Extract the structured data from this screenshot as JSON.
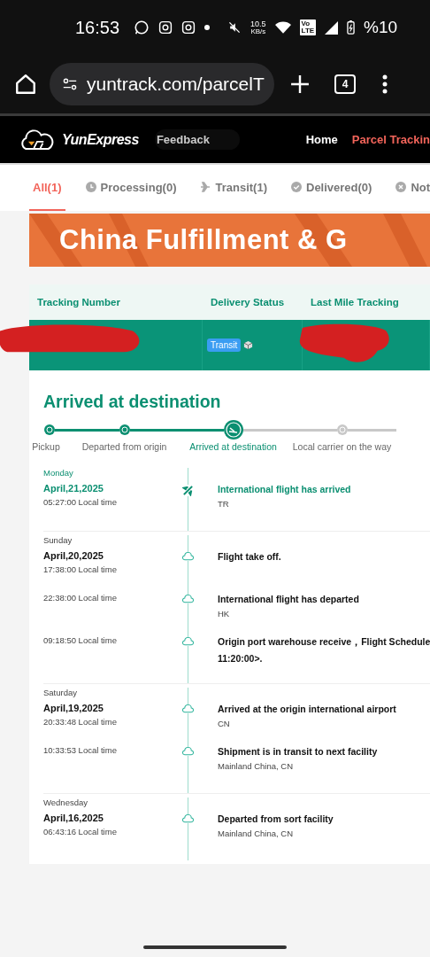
{
  "status_bar": {
    "time": "16:53",
    "speed": "10.5",
    "speed_unit": "KB/s",
    "volte": "Vo",
    "lte": "LTE",
    "battery": "%10"
  },
  "browser": {
    "url": "yuntrack.com/parcelT",
    "tab_count": "4"
  },
  "nav": {
    "brand": "YunExpress",
    "feedback": "Feedback",
    "links": [
      {
        "label": "Home",
        "selected": false
      },
      {
        "label": "Parcel Trackin",
        "selected": true
      }
    ]
  },
  "filter_tabs": [
    {
      "label": "All(1)",
      "kind": "all",
      "selected": true
    },
    {
      "label": "Processing(0)",
      "kind": "processing",
      "selected": false
    },
    {
      "label": "Transit(1)",
      "kind": "transit",
      "selected": false
    },
    {
      "label": "Delivered(0)",
      "kind": "delivered",
      "selected": false
    },
    {
      "label": "Not",
      "kind": "not",
      "selected": false
    }
  ],
  "banner": {
    "text": "China Fulfillment & G"
  },
  "table": {
    "columns": [
      "Tracking Number",
      "Delivery Status",
      "Last Mile Tracking"
    ],
    "row": {
      "status": "Transit"
    }
  },
  "detail": {
    "heading": "Arrived at destination",
    "steps": [
      {
        "label": "Pickup",
        "done": true,
        "current": false
      },
      {
        "label": "Departed from origin",
        "done": true,
        "current": false
      },
      {
        "label": "Arrived at destination",
        "done": true,
        "current": true
      },
      {
        "label": "Local carrier on the way",
        "done": false,
        "current": false
      }
    ],
    "days": [
      {
        "weekday": "Monday",
        "date": "April,21,2025",
        "latest": true,
        "events": [
          {
            "time": "05:27:00 Local time",
            "kind": "flight",
            "lines": [
              "International flight has arrived"
            ],
            "place": "TR"
          }
        ]
      },
      {
        "weekday": "Sunday",
        "date": "April,20,2025",
        "latest": false,
        "events": [
          {
            "time": "17:38:00 Local time",
            "lines": [
              "Flight take off."
            ]
          },
          {
            "time": "22:38:00 Local time",
            "lines": [
              "International flight has departed"
            ],
            "place": "HK"
          },
          {
            "time": "09:18:50 Local time",
            "lines": [
              "Origin port warehouse receive，Flight Schedule",
              "11:20:00>."
            ]
          }
        ]
      },
      {
        "weekday": "Saturday",
        "date": "April,19,2025",
        "latest": false,
        "events": [
          {
            "time": "20:33:48 Local time",
            "lines": [
              "Arrived at the origin international airport"
            ],
            "place": "CN"
          },
          {
            "time": "10:33:53 Local time",
            "lines": [
              "Shipment is in transit to next facility"
            ],
            "place": "Mainland China, CN"
          }
        ]
      },
      {
        "weekday": "Wednesday",
        "date": "April,16,2025",
        "latest": false,
        "events": [
          {
            "time": "06:43:16 Local time",
            "lines": [
              "Departed from sort facility"
            ],
            "place": "Mainland China, CN"
          }
        ]
      }
    ]
  }
}
